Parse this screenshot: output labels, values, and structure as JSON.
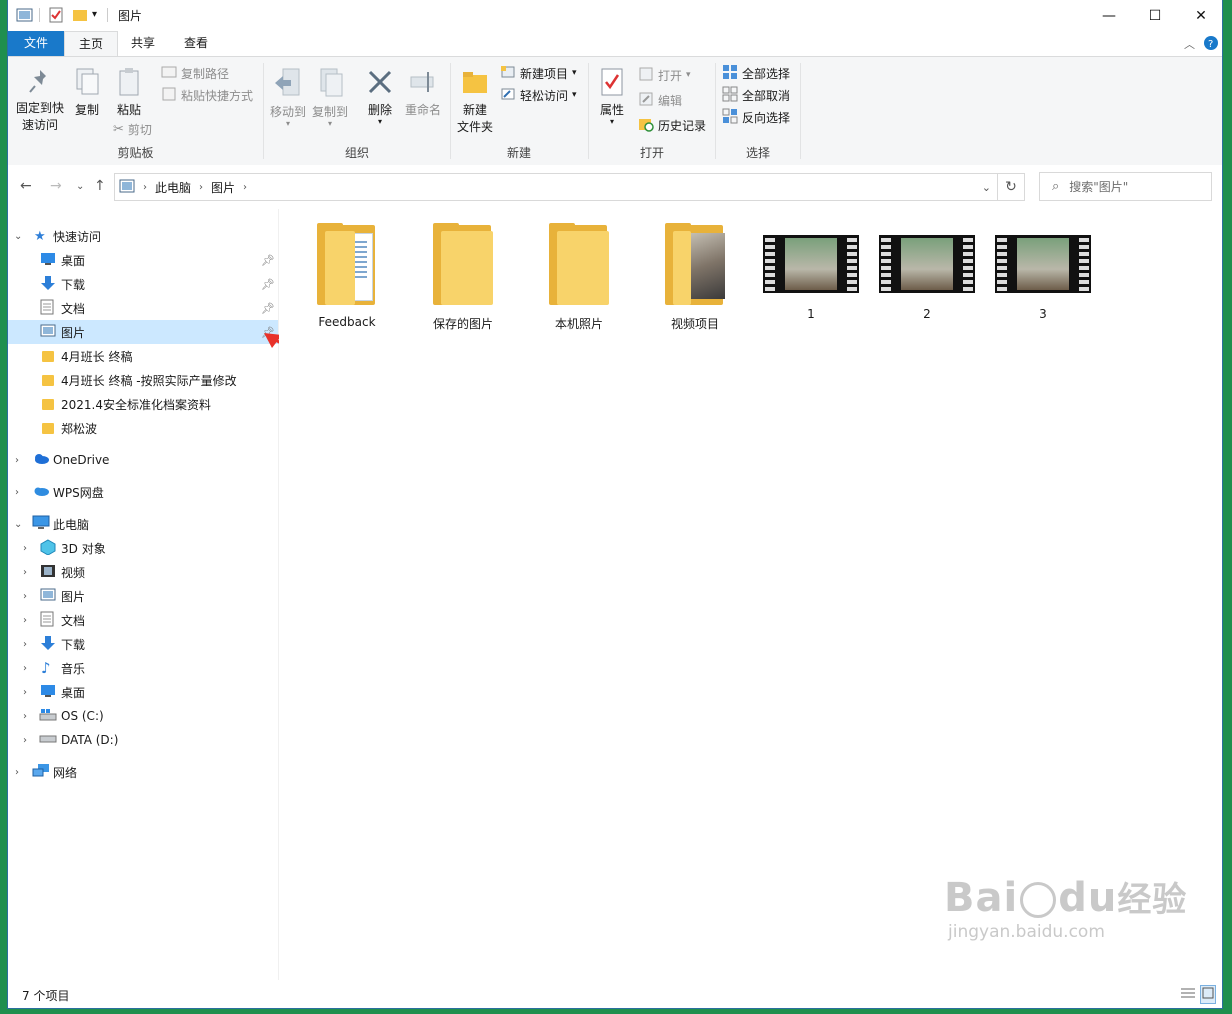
{
  "window": {
    "title": "图片",
    "controls": [
      "minimize",
      "maximize",
      "close"
    ]
  },
  "tabs": [
    {
      "label": "文件"
    },
    {
      "label": "主页"
    },
    {
      "label": "共享"
    },
    {
      "label": "查看"
    }
  ],
  "ribbon": {
    "clipboard": {
      "group_label": "剪贴板",
      "pin_label": "固定到快\n速访问",
      "pin_label_1": "固定到快",
      "pin_label_2": "速访问",
      "copy_label": "复制",
      "paste_label": "粘贴",
      "copy_path_label": "复制路径",
      "paste_shortcut_label": "粘贴快捷方式",
      "cut_label": "剪切"
    },
    "organize": {
      "group_label": "组织",
      "move_to_label": "移动到",
      "copy_to_label": "复制到",
      "delete_label": "删除",
      "rename_label": "重命名"
    },
    "new": {
      "group_label": "新建",
      "new_folder_label_1": "新建",
      "new_folder_label_2": "文件夹",
      "new_item_label": "新建项目",
      "easy_access_label": "轻松访问"
    },
    "open": {
      "group_label": "打开",
      "properties_label": "属性",
      "open_label": "打开",
      "edit_label": "编辑",
      "history_label": "历史记录"
    },
    "select": {
      "group_label": "选择",
      "select_all_label": "全部选择",
      "select_none_label": "全部取消",
      "invert_label": "反向选择"
    }
  },
  "address": {
    "crumbs": [
      "此电脑",
      "图片"
    ],
    "search_placeholder": "搜索\"图片\""
  },
  "nav_pane": {
    "quick_access": {
      "label": "快速访问",
      "items": [
        {
          "label": "桌面",
          "icon": "desktop-icon",
          "pinned": true
        },
        {
          "label": "下载",
          "icon": "download-icon",
          "pinned": true
        },
        {
          "label": "文档",
          "icon": "document-icon",
          "pinned": true
        },
        {
          "label": "图片",
          "icon": "pictures-icon",
          "pinned": true,
          "selected": true
        },
        {
          "label": "4月班长  终稿",
          "icon": "folder-icon"
        },
        {
          "label": "4月班长  终稿 -按照实际产量修改",
          "icon": "folder-icon"
        },
        {
          "label": "2021.4安全标准化档案资料",
          "icon": "folder-icon"
        },
        {
          "label": "郑松波",
          "icon": "folder-icon"
        }
      ]
    },
    "onedrive": {
      "label": "OneDrive"
    },
    "wps": {
      "label": "WPS网盘"
    },
    "this_pc": {
      "label": "此电脑",
      "items": [
        {
          "label": "3D 对象",
          "icon": "3d-objects-icon"
        },
        {
          "label": "视频",
          "icon": "videos-icon"
        },
        {
          "label": "图片",
          "icon": "pictures-icon"
        },
        {
          "label": "文档",
          "icon": "document-icon"
        },
        {
          "label": "下载",
          "icon": "download-icon"
        },
        {
          "label": "音乐",
          "icon": "music-icon"
        },
        {
          "label": "桌面",
          "icon": "desktop-icon"
        },
        {
          "label": "OS (C:)",
          "icon": "os-drive-icon"
        },
        {
          "label": "DATA (D:)",
          "icon": "drive-icon"
        }
      ]
    },
    "network": {
      "label": "网络"
    }
  },
  "content": {
    "items": [
      {
        "name": "Feedback",
        "kind": "folder"
      },
      {
        "name": "保存的图片",
        "kind": "folder"
      },
      {
        "name": "本机照片",
        "kind": "folder"
      },
      {
        "name": "视频项目",
        "kind": "folder"
      },
      {
        "name": "1",
        "kind": "video"
      },
      {
        "name": "2",
        "kind": "video"
      },
      {
        "name": "3",
        "kind": "video"
      }
    ]
  },
  "status": {
    "count_text": "7 个项目"
  },
  "watermark": {
    "brand": "Bai",
    "brand2": "du",
    "cn": "经验",
    "url": "jingyan.baidu.com"
  },
  "colors": {
    "file_tab": "#1979ca",
    "selection": "#cce8ff",
    "folder": "#f5c342",
    "desktop_bg": "#1f8f4e",
    "arrow": "#e8322a"
  }
}
